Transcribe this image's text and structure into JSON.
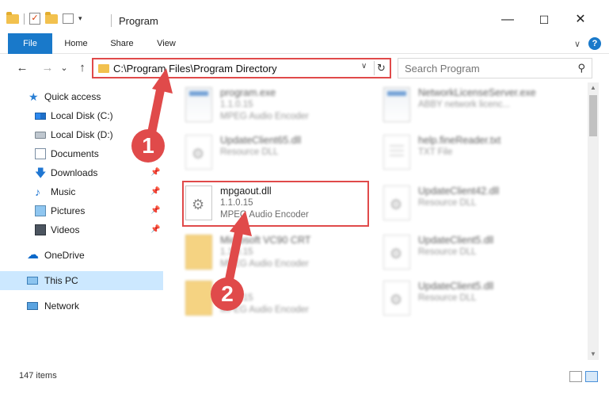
{
  "window": {
    "title": "Program",
    "minimize_glyph": "—",
    "maximize_glyph": "☐",
    "close_glyph": "✕",
    "quick_access": {
      "checkmark_glyph": "✓",
      "dropdown_glyph": "▾"
    }
  },
  "ribbon": {
    "tabs": [
      {
        "label": "File"
      },
      {
        "label": "Home"
      },
      {
        "label": "Share"
      },
      {
        "label": "View"
      }
    ],
    "expand_glyph": "∨",
    "help_glyph": "?"
  },
  "navigation": {
    "back_glyph": "←",
    "forward_glyph": "→",
    "recent_glyph": "⌄",
    "up_glyph": "↑"
  },
  "address": {
    "path": "C:\\Program Files\\Program Directory",
    "dropdown_glyph": "∨",
    "refresh_glyph": "↻"
  },
  "search": {
    "placeholder": "Search Program",
    "icon_glyph": "⚲"
  },
  "sidebar": {
    "pin_glyph": "📌",
    "items": [
      {
        "label": "Quick access",
        "icon": "star-icon",
        "glyph": "★"
      },
      {
        "label": "Local Disk (C:)",
        "icon": "drive-icon"
      },
      {
        "label": "Local Disk (D:)",
        "icon": "drive-icon"
      },
      {
        "label": "Documents",
        "icon": "document-icon"
      },
      {
        "label": "Downloads",
        "icon": "download-icon",
        "glyph": "🡇",
        "pinned": true
      },
      {
        "label": "Music",
        "icon": "music-icon",
        "glyph": "♪",
        "pinned": true
      },
      {
        "label": "Pictures",
        "icon": "picture-icon",
        "pinned": true
      },
      {
        "label": "Videos",
        "icon": "video-icon",
        "pinned": true
      },
      {
        "label": "OneDrive",
        "icon": "cloud-icon",
        "glyph": "☁"
      },
      {
        "label": "This PC",
        "icon": "computer-icon",
        "selected": true
      },
      {
        "label": "Network",
        "icon": "network-icon"
      }
    ]
  },
  "files": {
    "gear_glyph": "⚙",
    "items": [
      {
        "name": "program.exe",
        "line2": "1.1.0.15",
        "line3": "MPEG Audio Encoder",
        "icon": "exe"
      },
      {
        "name": "NetworkLicenseServer.exe",
        "line2": "ABBY network licenc...",
        "line3": "",
        "icon": "exe"
      },
      {
        "name": "UpdateClient65.dll",
        "line2": "Resource DLL",
        "line3": "",
        "icon": "dll"
      },
      {
        "name": "help.fineReader.txt",
        "line2": "TXT File",
        "line3": "",
        "icon": "txt"
      },
      {
        "name": "mpgaout.dll",
        "line2": "1.1.0.15",
        "line3": "MPEG Audio Encoder",
        "icon": "dll",
        "highlighted": true
      },
      {
        "name": "UpdateClient42.dll",
        "line2": "Resource DLL",
        "line3": "",
        "icon": "dll"
      },
      {
        "name": "Microsoft VC90 CRT",
        "line2": "1.1.0.15",
        "line3": "MPEG Audio Encoder",
        "icon": "folder"
      },
      {
        "name": "UpdateClient5.dll",
        "line2": "Resource DLL",
        "line3": "",
        "icon": "dll"
      },
      {
        "name": "",
        "line2": "1.1.0.15",
        "line3": "MPEG Audio Encoder",
        "icon": "folder"
      },
      {
        "name": "UpdateClient5.dll",
        "line2": "Resource DLL",
        "line3": "",
        "icon": "dll"
      }
    ]
  },
  "scrollbar": {
    "up_glyph": "▲",
    "down_glyph": "▼"
  },
  "status": {
    "item_count": "147 items"
  },
  "annotations": {
    "step1": "1",
    "step2": "2",
    "color": "#e04a4a"
  }
}
